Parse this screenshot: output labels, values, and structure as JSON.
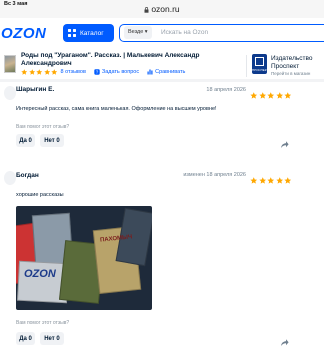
{
  "statusbar": {
    "time": "Вс 3 мая",
    "url": "ozon.ru"
  },
  "header": {
    "logo": "OZON",
    "catalog_label": "Каталог",
    "search_scope": "Везде",
    "search_placeholder": "Искать на Ozon"
  },
  "product": {
    "title": "Роды под \"Ураганом\". Рассказ. | Малькевич Александр Александрович",
    "rating_stars": 5,
    "reviews_count": "8 отзывов",
    "ask_question": "Задать вопрос",
    "compare": "Сравнивать",
    "seller_name_line1": "Издательство",
    "seller_name_line2": "Проспект",
    "seller_link": "Перейти в магазин",
    "seller_logo_text": "ПРОСПЕКТ"
  },
  "reviews": [
    {
      "author": "Шарыгин Е.",
      "date": "18 апреля 2026",
      "stars": 5,
      "text": "Интересный рассказ, сама книга маленькая. Оформление на высшем уровне!",
      "helpful_question": "Вам помог этот отзыв?",
      "yes_label": "Да 0",
      "no_label": "Нет 0"
    },
    {
      "author": "Богдан",
      "date": "изменен 18 апреля 2026",
      "stars": 5,
      "text": "хорошие рассказы",
      "photo_labels": [
        "OZON",
        "ПАХОМЫЧ"
      ],
      "helpful_question": "Вам помог этот отзыв?",
      "yes_label": "Да 0",
      "no_label": "Нет 0"
    }
  ],
  "colors": {
    "brand_blue": "#005bff",
    "star_orange": "#ffa800",
    "text_dark": "#001a34",
    "muted": "#70808f"
  }
}
